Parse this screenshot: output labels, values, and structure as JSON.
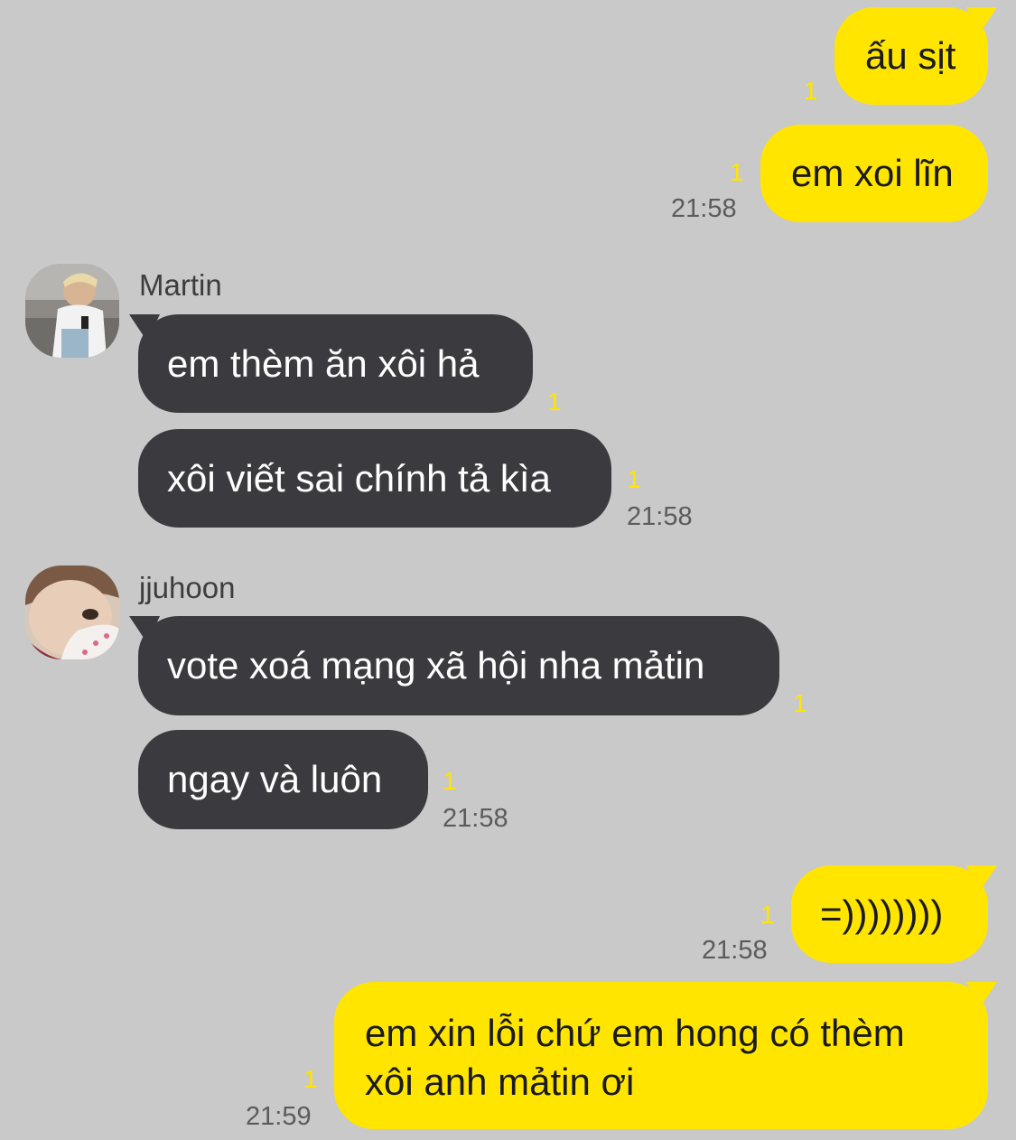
{
  "colors": {
    "background": "#c9c9c9",
    "my_bubble": "#ffe500",
    "their_bubble": "#3b3b3f",
    "unread_count": "#ffe500"
  },
  "messages": [
    {
      "sender": "me",
      "text": "ấu sịt",
      "unread": "1"
    },
    {
      "sender": "me",
      "text": "em xoi lĩn",
      "unread": "1",
      "time": "21:58"
    },
    {
      "sender": "Martin",
      "name": "Martin",
      "text": "em thèm ăn xôi hả",
      "unread": "1"
    },
    {
      "sender": "Martin",
      "text": "xôi viết sai chính tả kìa",
      "unread": "1",
      "time": "21:58"
    },
    {
      "sender": "jjuhoon",
      "name": "jjuhoon",
      "text": "vote xoá mạng xã hội nha mảtin",
      "unread": "1"
    },
    {
      "sender": "jjuhoon",
      "text": "ngay và luôn",
      "unread": "1",
      "time": "21:58"
    },
    {
      "sender": "me",
      "text": "=))))))))",
      "unread": "1",
      "time": "21:58"
    },
    {
      "sender": "me",
      "lines": [
        "em xin lỗi chứ em hong có thèm",
        "xôi anh mảtin ơi"
      ],
      "unread": "1",
      "time": "21:59"
    }
  ],
  "avatars": {
    "martin": "photo-avatar",
    "jjuhoon": "photo-avatar"
  }
}
